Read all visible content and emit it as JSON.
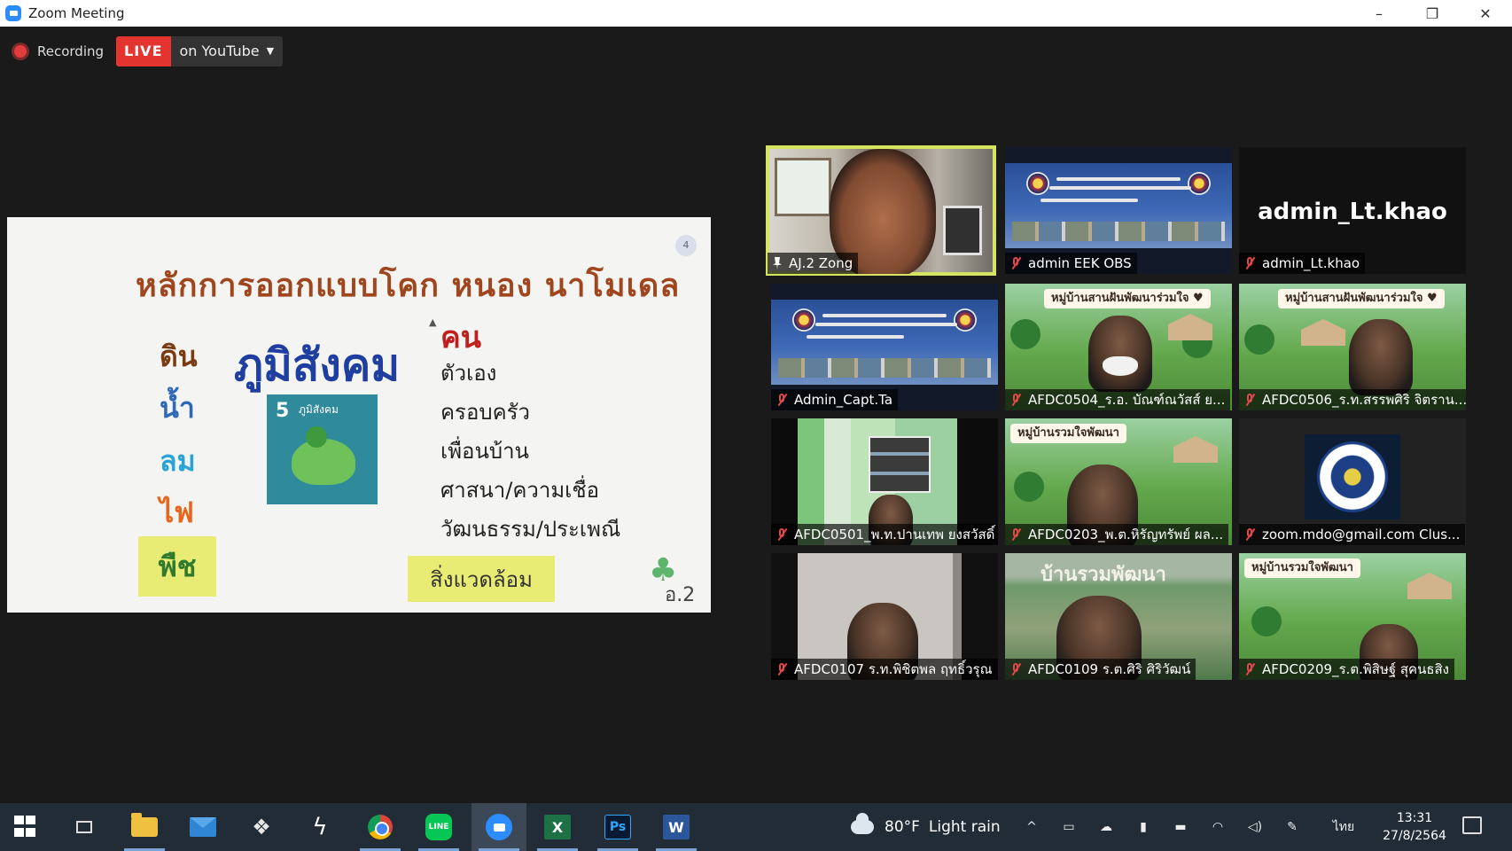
{
  "window": {
    "title": "Zoom Meeting",
    "controls": [
      "–",
      "❐",
      "✕"
    ]
  },
  "recording": {
    "label": "Recording",
    "live_badge": "LIVE",
    "destination": "on YouTube",
    "caret": "▼"
  },
  "slide": {
    "title": "หลักการออกแบบโคก หนอง นาโมเดล",
    "slide_number": "4",
    "elements": [
      "ดิน",
      "น้ำ",
      "ลม",
      "ไฟ",
      "พืช"
    ],
    "big_word": "ภูมิสังคม",
    "thumbnail": {
      "number": "5",
      "caption": "ภูมิสังคม"
    },
    "people_heading": "คน",
    "people_items": [
      "ตัวเอง",
      "ครอบครัว",
      "เพื่อนบ้าน",
      "ศาสนา/ความเชื่อ",
      "วัฒนธรรม/ประเพณี"
    ],
    "environment_box": "สิ่งแวดล้อม",
    "corner_label": "อ.2"
  },
  "participants": [
    {
      "name": "AJ.2 Zong",
      "active": true,
      "muted": false
    },
    {
      "name": "admin EEK OBS",
      "muted": true
    },
    {
      "name": "admin_Lt.khao",
      "muted": true,
      "display_name": "admin_Lt.khao"
    },
    {
      "name": "Admin_Capt.Ta",
      "muted": true
    },
    {
      "name": "AFDC0504_ร.อ. บัณฑ์ณวัสส์ ย...",
      "muted": true,
      "sign": "หมู่บ้านสานฝันพัฒนาร่วมใจ ♥"
    },
    {
      "name": "AFDC0506_ร.ท.สรรพศิริ จิตราน...",
      "muted": true,
      "sign": "หมู่บ้านสานฝันพัฒนาร่วมใจ ♥"
    },
    {
      "name": "AFDC0501_พ.ท.ปานเทพ ยงสวัสดิ์",
      "muted": true
    },
    {
      "name": "AFDC0203_พ.ต.หิรัญทรัพย์ ผล...",
      "muted": true,
      "sign": "หมู่บ้านรวมใจพัฒนา"
    },
    {
      "name": "zoom.mdo@gmail.com Clus...",
      "muted": true
    },
    {
      "name": "AFDC0107 ร.ท.พิชิตพล ฤทธิ์วรุณ",
      "muted": true
    },
    {
      "name": "AFDC0109 ร.ต.ศิริ ศิริวัฒน์",
      "muted": true,
      "heading": "บ้านรวมพัฒนา"
    },
    {
      "name": "AFDC0209_ร.ต.พิสิษฐ์ สุคนธสิง",
      "muted": true,
      "sign": "หมู่บ้านรวมใจพัฒนา"
    }
  ],
  "taskbar": {
    "apps": [
      "start",
      "task-view",
      "file-explorer",
      "mail",
      "dropbox",
      "bolt-app",
      "chrome",
      "line",
      "zoom",
      "excel",
      "photoshop",
      "word"
    ],
    "line_label": "LINE",
    "excel_label": "X",
    "ps_label": "Ps",
    "word_label": "W",
    "weather": {
      "temp": "80°F",
      "condition": "Light rain"
    },
    "tray": {
      "chevron": "^",
      "language": "ไทย"
    },
    "clock": {
      "time": "13:31",
      "date": "27/8/2564"
    }
  },
  "colors": {
    "active_speaker": "#d6e561",
    "live": "#e3342f",
    "muted_icon": "#e34848"
  }
}
